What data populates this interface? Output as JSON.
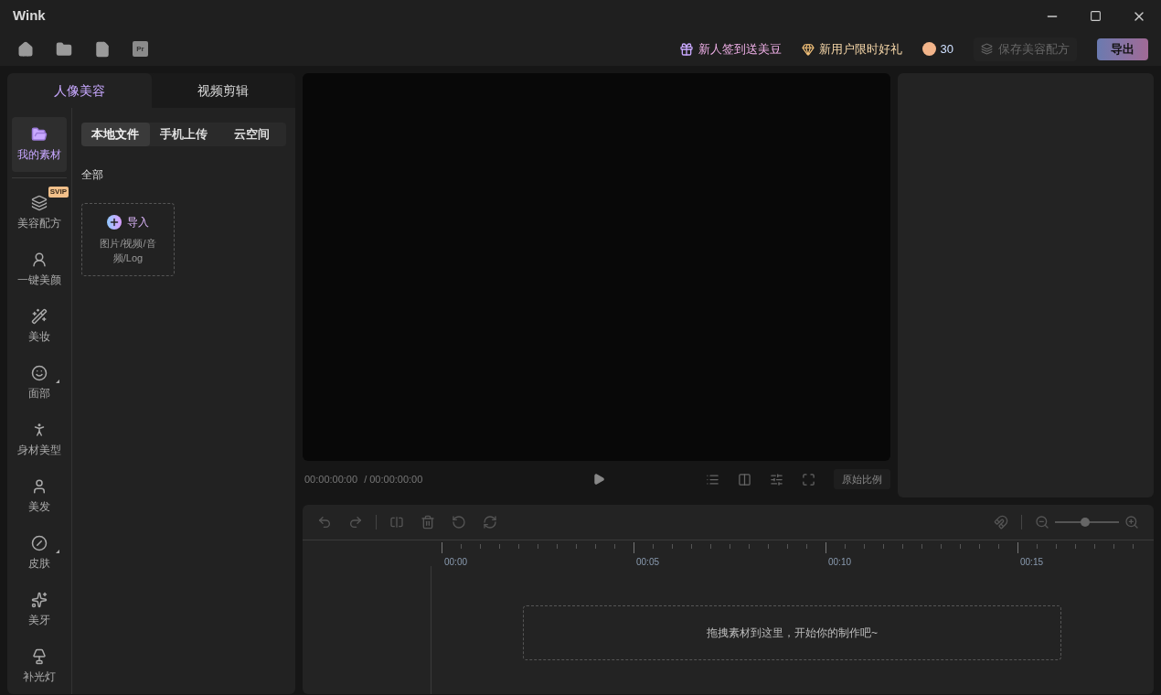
{
  "window": {
    "title": "Wink"
  },
  "toolbar": {
    "pr_label": "Pr"
  },
  "promos": [
    {
      "kind": "gift",
      "text": "新人签到送美豆"
    },
    {
      "kind": "diamond",
      "text": "新用户限时好礼"
    },
    {
      "kind": "bean",
      "text": "30"
    }
  ],
  "save_recipe": {
    "label": "保存美容配方",
    "disabled": true
  },
  "export_button": "导出",
  "main_tabs": [
    {
      "label": "人像美容",
      "selected": true
    },
    {
      "label": "视频剪辑",
      "selected": false
    }
  ],
  "sidebar": [
    {
      "label": "我的素材",
      "selected": true,
      "has_submenu": false
    },
    {
      "label": "美容配方",
      "selected": false,
      "badge": "SVIP",
      "has_submenu": false
    },
    {
      "label": "一键美颜",
      "selected": false,
      "has_submenu": false
    },
    {
      "label": "美妆",
      "selected": false,
      "has_submenu": false
    },
    {
      "label": "面部",
      "selected": false,
      "has_submenu": true
    },
    {
      "label": "身材美型",
      "selected": false,
      "has_submenu": false
    },
    {
      "label": "美发",
      "selected": false,
      "has_submenu": false
    },
    {
      "label": "皮肤",
      "selected": false,
      "has_submenu": true
    },
    {
      "label": "美牙",
      "selected": false,
      "has_submenu": false
    },
    {
      "label": "补光灯",
      "selected": false,
      "has_submenu": false
    }
  ],
  "source_tabs": [
    {
      "label": "本地文件",
      "selected": true
    },
    {
      "label": "手机上传",
      "selected": false
    },
    {
      "label": "云空间",
      "selected": false
    }
  ],
  "filter": "全部",
  "import": {
    "label": "导入",
    "hint": "图片/视频/音频/Log"
  },
  "player": {
    "current": "00:00:00:00",
    "total": "/ 00:00:00:00",
    "ratio_button": "原始比例"
  },
  "timeline": {
    "zoom": {
      "level": 0.47
    },
    "ticks": [
      "00:00",
      "00:05",
      "00:10",
      "00:15"
    ],
    "drop_hint": "拖拽素材到这里，开始你的制作吧~"
  }
}
